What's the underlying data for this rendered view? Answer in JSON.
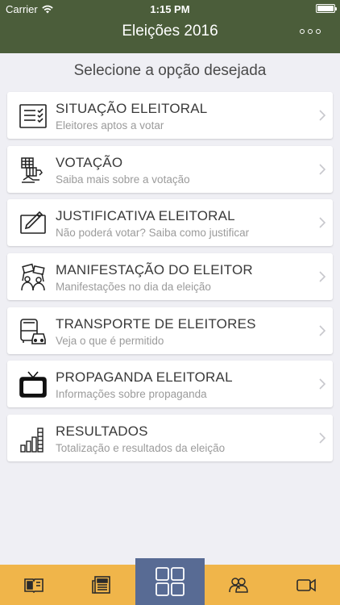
{
  "status": {
    "carrier": "Carrier",
    "time": "1:15 PM"
  },
  "nav": {
    "title": "Eleições 2016"
  },
  "subtitle": "Selecione a opção desejada",
  "items": [
    {
      "title": "SITUAÇÃO ELEITORAL",
      "description": "Eleitores aptos a votar",
      "icon": "checklist-icon"
    },
    {
      "title": "VOTAÇÃO",
      "description": "Saiba mais sobre a votação",
      "icon": "voting-machine-icon"
    },
    {
      "title": "JUSTIFICATIVA ELEITORAL",
      "description": "Não poderá votar? Saiba como justificar",
      "icon": "edit-pencil-icon"
    },
    {
      "title": "MANIFESTAÇÃO DO ELEITOR",
      "description": "Manifestações no dia da eleição",
      "icon": "protest-icon"
    },
    {
      "title": "TRANSPORTE DE ELEITORES",
      "description": "Veja o que é permitido",
      "icon": "bus-car-icon"
    },
    {
      "title": "PROPAGANDA ELEITORAL",
      "description": "Informações sobre propaganda",
      "icon": "tv-icon"
    },
    {
      "title": "RESULTADOS",
      "description": "Totalização e resultados da eleição",
      "icon": "bar-chart-icon"
    }
  ],
  "tabs": [
    {
      "icon": "book-icon",
      "active": false
    },
    {
      "icon": "newspaper-icon",
      "active": false
    },
    {
      "icon": "grid-icon",
      "active": true
    },
    {
      "icon": "people-icon",
      "active": false
    },
    {
      "icon": "video-camera-icon",
      "active": false
    }
  ],
  "colors": {
    "nav_background": "#4b5d3a",
    "tabbar_background": "#f0b54a",
    "active_tab": "#586b94",
    "page_background": "#efeff4"
  }
}
